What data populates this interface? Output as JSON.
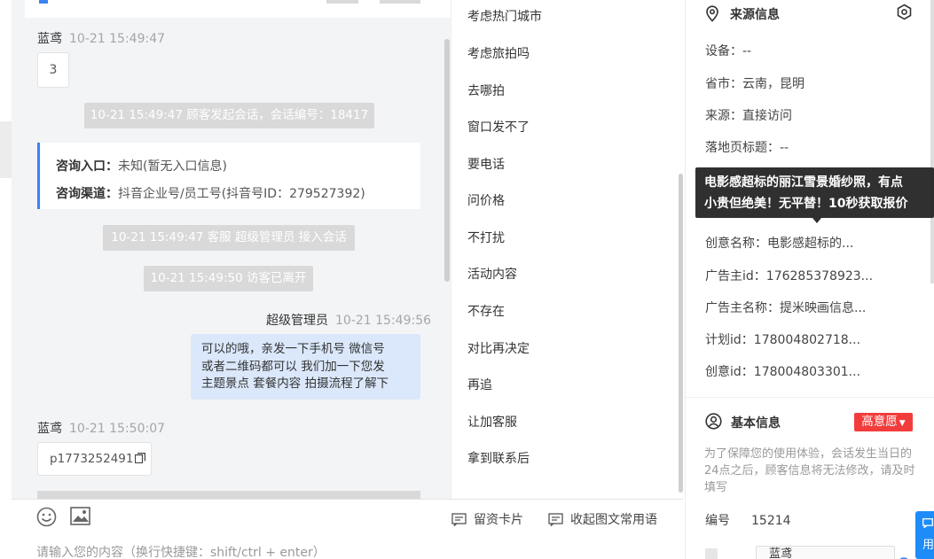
{
  "chat": {
    "messages": [
      {
        "sender": "蓝鸢",
        "time": "10-21 15:49:47",
        "content": "3"
      },
      {
        "system": "10-21 15:49:47 顾客发起会话，会话编号：18417"
      },
      {
        "system": "10-21 15:49:47 客服 超级管理员 接入会话"
      },
      {
        "system": "10-21 15:49:50 访客已离开"
      },
      {
        "sender": "超级管理员",
        "time": "10-21 15:49:56",
        "lines": [
          "可以的哦，亲发一下手机号 微信号",
          "或者二维码都可以 我们加一下您发",
          "主题景点 套餐内容 拍摄流程了解下"
        ]
      },
      {
        "sender": "蓝鸢",
        "time": "10-21 15:50:07",
        "content": "p1773252491"
      }
    ],
    "info_card": {
      "entry_label": "咨询入口：",
      "entry_value": "未知(暂无入口信息)",
      "channel_label": "咨询渠道：",
      "channel_value": "抖音企业号/员工号(抖音号ID：279527392)"
    }
  },
  "composer": {
    "placeholder": "请输入您的内容（换行快捷键：shift/ctrl + enter）",
    "tools": {
      "card": "留资卡片",
      "favorites": "收起图文常用语"
    },
    "icons": {
      "emoji": "emoji-icon",
      "image": "image-icon",
      "card": "card-icon",
      "favorites": "message-icon",
      "copy": "copy-icon"
    }
  },
  "quick_replies": [
    "考虑热门城市",
    "考虑旅拍吗",
    "去哪拍",
    "窗口发不了",
    "要电话",
    "问价格",
    "不打扰",
    "活动内容",
    "不存在",
    "对比再决定",
    "再追",
    "让加客服",
    "拿到联系后"
  ],
  "source_info": {
    "title": "来源信息",
    "rows": [
      {
        "label": "设备：",
        "value": "--"
      },
      {
        "label": "省市：",
        "value": "云南，昆明"
      },
      {
        "label": "来源：",
        "value": "直接访问"
      },
      {
        "label": "落地页标题：",
        "value": "--"
      },
      {
        "label": "创意名称：",
        "value": "电影感超标的..."
      },
      {
        "label": "广告主id：",
        "value": "176285378923..."
      },
      {
        "label": "广告主名称：",
        "value": "提米映画信息..."
      },
      {
        "label": "计划id：",
        "value": "178004802718..."
      },
      {
        "label": "创意id：",
        "value": "178004803301..."
      }
    ],
    "tooltip": [
      "电影感超标的丽江雪景婚纱照，有点",
      "小贵但绝美！无平替！10秒获取报价"
    ]
  },
  "basic_info": {
    "title": "基本信息",
    "badge": "高意愿",
    "note": "为了保障您的使用体验，会话发生当日的24点之后，顾客信息将无法修改，请及时填写",
    "number_label": "编号",
    "number_value": "15214",
    "name_value": "蓝鸢",
    "float_label": "用"
  },
  "colors": {
    "accent": "#3b82f6",
    "badge": "#f23c3c",
    "my_bubble": "#dbe8fb",
    "system_pill": "#d9d9d9"
  }
}
